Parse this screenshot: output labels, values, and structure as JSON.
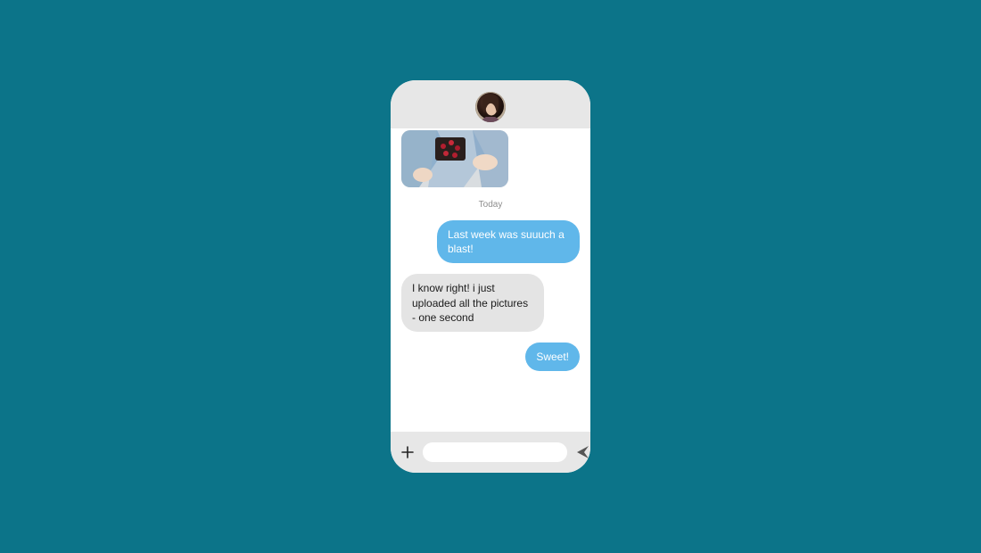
{
  "colors": {
    "background": "#0c7489",
    "sent_bubble": "#60b7ea",
    "recv_bubble": "#e4e4e4",
    "chrome": "#e7e7e7"
  },
  "header": {
    "avatar_alt": "contact-avatar"
  },
  "thread": {
    "attachment_alt": "shared-photo",
    "date_label": "Today",
    "messages": [
      {
        "side": "sent",
        "text": "Last week was suuuch a blast!"
      },
      {
        "side": "recv",
        "text": "I know right! i just uploaded all the pictures - one second"
      },
      {
        "side": "sent",
        "text": "Sweet!"
      }
    ]
  },
  "composer": {
    "placeholder": "",
    "value": ""
  }
}
